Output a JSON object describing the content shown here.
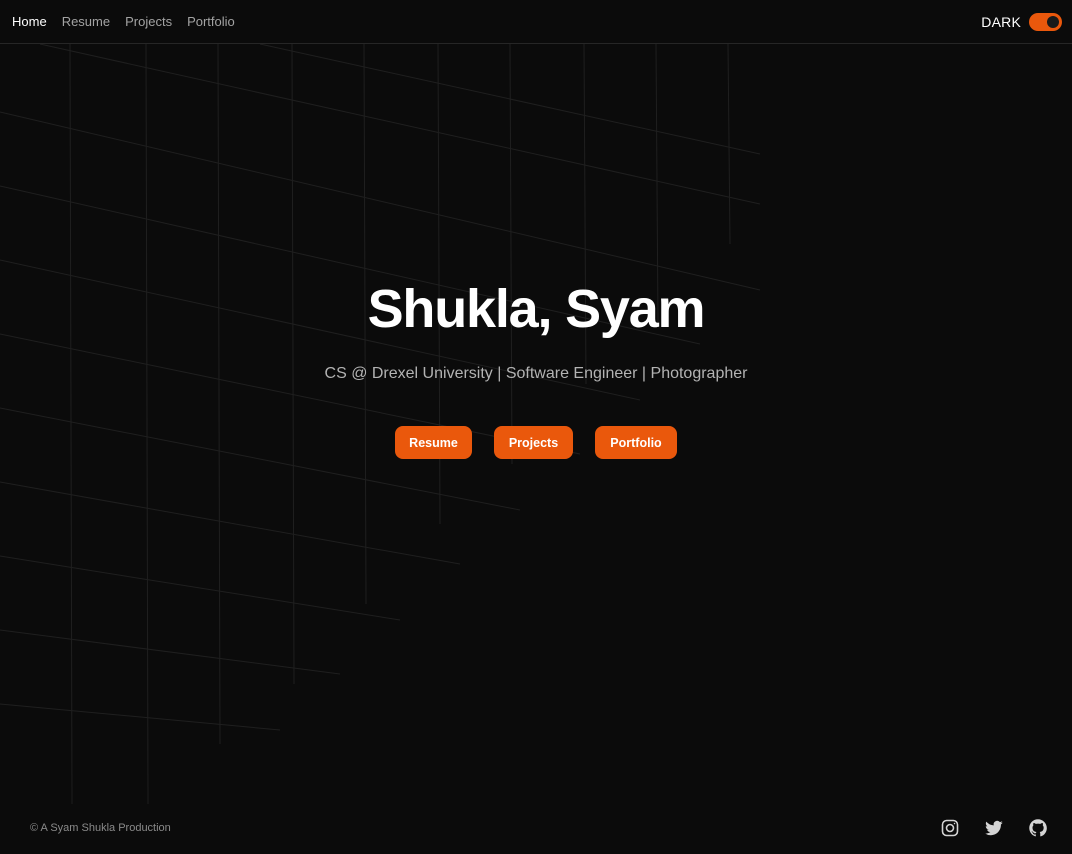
{
  "nav": {
    "links": [
      {
        "label": "Home",
        "active": true
      },
      {
        "label": "Resume",
        "active": false
      },
      {
        "label": "Projects",
        "active": false
      },
      {
        "label": "Portfolio",
        "active": false
      }
    ],
    "theme_label": "DARK",
    "theme_toggle_on": true
  },
  "hero": {
    "title": "Shukla, Syam",
    "subtitle": "CS @ Drexel University | Software Engineer | Photographer",
    "buttons": [
      {
        "label": "Resume"
      },
      {
        "label": "Projects"
      },
      {
        "label": "Portfolio"
      }
    ]
  },
  "footer": {
    "copyright": "© A Syam Shukla Production",
    "socials": [
      {
        "icon": "instagram-icon"
      },
      {
        "icon": "twitter-icon"
      },
      {
        "icon": "github-icon"
      }
    ]
  },
  "colors": {
    "background": "#0b0b0b",
    "accent": "#ea580c",
    "text": "#ffffff",
    "muted": "#a3a3a3"
  }
}
